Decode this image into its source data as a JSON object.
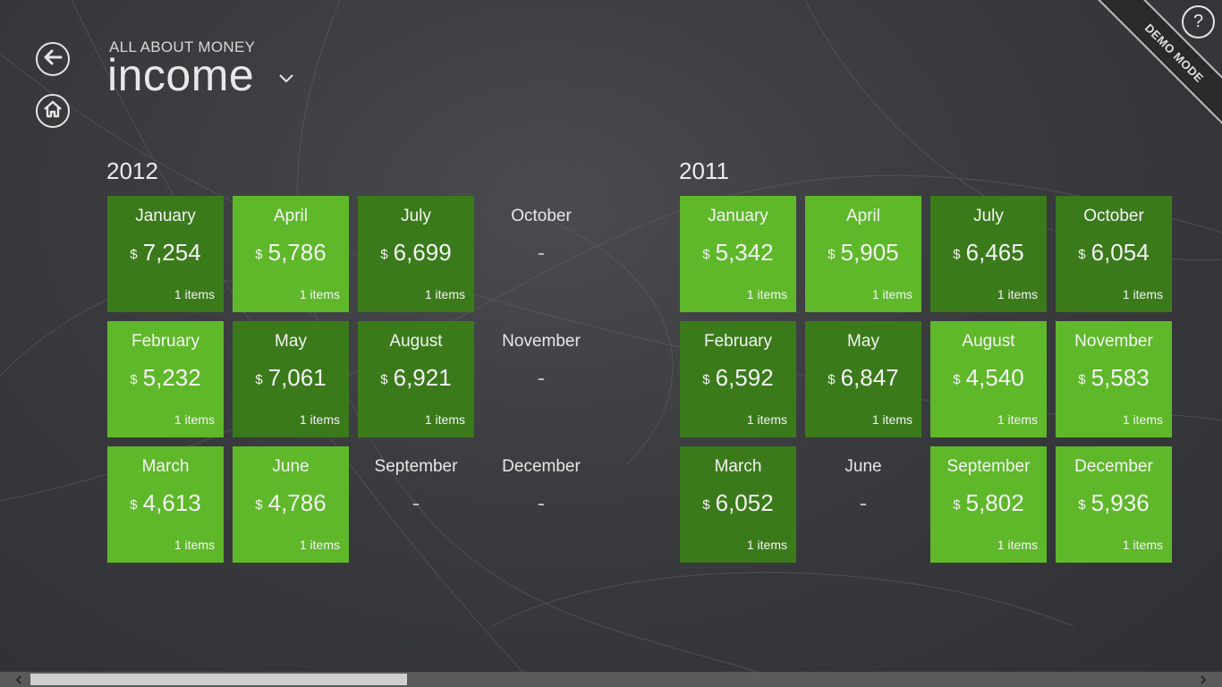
{
  "header": {
    "subtitle": "ALL ABOUT MONEY",
    "title": "income",
    "demo_label": "DEMO MODE",
    "help_label": "?"
  },
  "currency_symbol": "$",
  "years": [
    {
      "year": "2012",
      "months": [
        {
          "name": "January",
          "amount": "7,254",
          "items": "1 items",
          "shade": "dark"
        },
        {
          "name": "February",
          "amount": "5,232",
          "items": "1 items",
          "shade": "light"
        },
        {
          "name": "March",
          "amount": "4,613",
          "items": "1 items",
          "shade": "light"
        },
        {
          "name": "April",
          "amount": "5,786",
          "items": "1 items",
          "shade": "light"
        },
        {
          "name": "May",
          "amount": "7,061",
          "items": "1 items",
          "shade": "dark"
        },
        {
          "name": "June",
          "amount": "4,786",
          "items": "1 items",
          "shade": "light"
        },
        {
          "name": "July",
          "amount": "6,699",
          "items": "1 items",
          "shade": "dark"
        },
        {
          "name": "August",
          "amount": "6,921",
          "items": "1 items",
          "shade": "dark"
        },
        {
          "name": "September",
          "amount": "-",
          "items": "",
          "shade": "empty"
        },
        {
          "name": "October",
          "amount": "-",
          "items": "",
          "shade": "empty"
        },
        {
          "name": "November",
          "amount": "-",
          "items": "",
          "shade": "empty"
        },
        {
          "name": "December",
          "amount": "-",
          "items": "",
          "shade": "empty"
        }
      ]
    },
    {
      "year": "2011",
      "months": [
        {
          "name": "January",
          "amount": "5,342",
          "items": "1 items",
          "shade": "light"
        },
        {
          "name": "February",
          "amount": "6,592",
          "items": "1 items",
          "shade": "dark"
        },
        {
          "name": "March",
          "amount": "6,052",
          "items": "1 items",
          "shade": "dark"
        },
        {
          "name": "April",
          "amount": "5,905",
          "items": "1 items",
          "shade": "light"
        },
        {
          "name": "May",
          "amount": "6,847",
          "items": "1 items",
          "shade": "dark"
        },
        {
          "name": "June",
          "amount": "-",
          "items": "",
          "shade": "empty"
        },
        {
          "name": "July",
          "amount": "6,465",
          "items": "1 items",
          "shade": "dark"
        },
        {
          "name": "August",
          "amount": "4,540",
          "items": "1 items",
          "shade": "light"
        },
        {
          "name": "September",
          "amount": "5,802",
          "items": "1 items",
          "shade": "light"
        },
        {
          "name": "October",
          "amount": "6,054",
          "items": "1 items",
          "shade": "dark"
        },
        {
          "name": "November",
          "amount": "5,583",
          "items": "1 items",
          "shade": "light"
        },
        {
          "name": "December",
          "amount": "5,936",
          "items": "1 items",
          "shade": "light"
        }
      ]
    }
  ],
  "colors": {
    "tile_light": "#5fb82a",
    "tile_dark": "#3b7a1b",
    "background": "#3a3b3e"
  },
  "icons": {
    "back": "back-arrow-icon",
    "home": "home-icon",
    "dropdown": "chevron-down-icon",
    "help": "question-icon"
  }
}
